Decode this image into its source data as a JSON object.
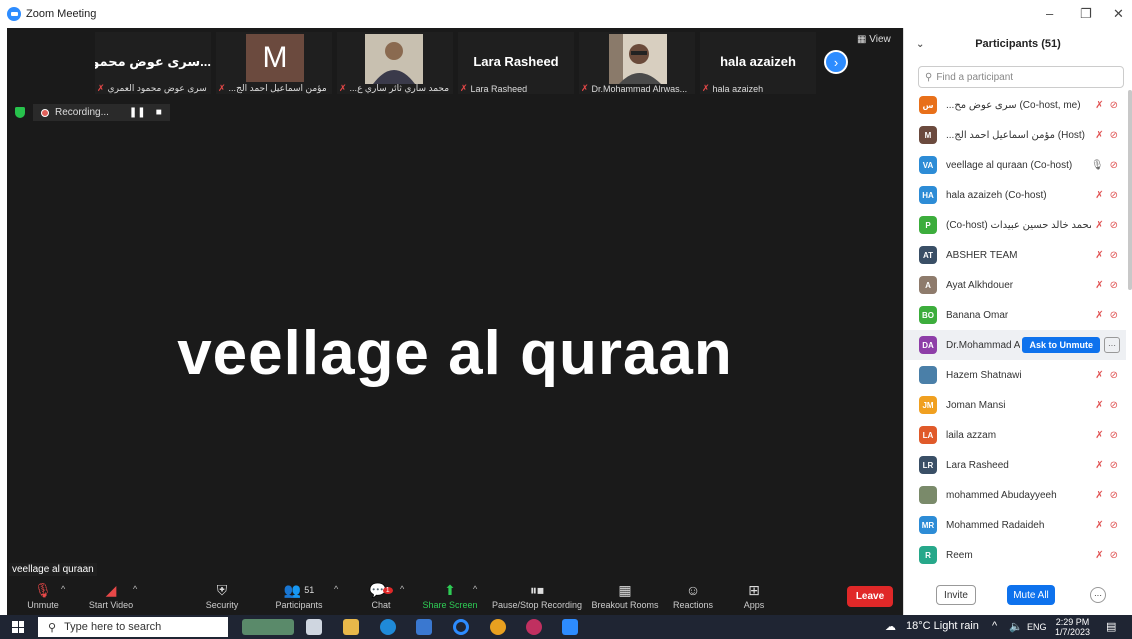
{
  "window": {
    "title": "Zoom Meeting",
    "controls": [
      "–",
      "❐",
      "✕"
    ]
  },
  "strip": {
    "tiles": [
      {
        "big": "...سرى عوض محمود",
        "caption": "سرى عوض محمود العمري"
      },
      {
        "big": "M",
        "caption": "...مؤمن اسماعيل احمد الج"
      },
      {
        "big": "",
        "caption": "...محمد ساري ثائر ساري ع"
      },
      {
        "big": "Lara Rasheed",
        "caption": "Lara Rasheed"
      },
      {
        "big": "",
        "caption": "Dr.Mohammad Alrwas..."
      },
      {
        "big": "hala azaizeh",
        "caption": "hala azaizeh"
      }
    ],
    "view_label": "View"
  },
  "recording": {
    "label": "Recording..."
  },
  "speaker": {
    "name": "veellage al quraan",
    "label": "veellage al quraan"
  },
  "toolbar": {
    "unmute": "Unmute",
    "start_video": "Start Video",
    "security": "Security",
    "participants": "Participants",
    "participants_count": "51",
    "chat": "Chat",
    "chat_badge": "1",
    "share_screen": "Share Screen",
    "pause_stop": "Pause/Stop Recording",
    "breakout": "Breakout Rooms",
    "reactions": "Reactions",
    "apps": "Apps",
    "leave": "Leave"
  },
  "participants_panel": {
    "title": "Participants (51)",
    "search_placeholder": "Find a participant",
    "rows": [
      {
        "initials": "س",
        "name": "...سرى عوض مح (Co-host, me)",
        "color": "#e8701a"
      },
      {
        "initials": "M",
        "name": "...مؤمن اسماعيل احمد الج (Host)",
        "color": "#6b4a3e"
      },
      {
        "initials": "VA",
        "name": "veellage al quraan (Co-host)",
        "color": "#2d8cd6"
      },
      {
        "initials": "HA",
        "name": "hala azaizeh (Co-host)",
        "color": "#2d8cd6"
      },
      {
        "initials": "P",
        "name": "(Co-host) محمد خالد حسين عبيدات",
        "color": "#3cad3c"
      },
      {
        "initials": "AT",
        "name": "ABSHER TEAM",
        "color": "#3a4f66"
      },
      {
        "initials": "A",
        "name": "Ayat Alkhdouer",
        "color": "#8e7b6c"
      },
      {
        "initials": "BO",
        "name": "Banana Omar",
        "color": "#3cad3c"
      },
      {
        "initials": "DA",
        "name": "Dr.Mohammad A",
        "color": "#8e3ea8"
      },
      {
        "initials": "",
        "name": "Hazem Shatnawi",
        "color": "#4a7fa8"
      },
      {
        "initials": "JM",
        "name": "Joman Mansi",
        "color": "#f0a020"
      },
      {
        "initials": "LA",
        "name": "laila azzam",
        "color": "#e05a2a"
      },
      {
        "initials": "LR",
        "name": "Lara Rasheed",
        "color": "#3a4f66"
      },
      {
        "initials": "",
        "name": "mohammed Abudayyeeh",
        "color": "#7a8a6a"
      },
      {
        "initials": "MR",
        "name": "Mohammed Radaideh",
        "color": "#2d8cd6"
      },
      {
        "initials": "R",
        "name": "Reem",
        "color": "#27a88a"
      }
    ],
    "ask_to_unmute": "Ask to Unmute",
    "invite": "Invite",
    "mute_all": "Mute All"
  },
  "taskbar": {
    "search_placeholder": "Type here to search",
    "weather": "18°C  Light rain",
    "lang": "ENG",
    "time": "2:29 PM",
    "date": "1/7/2023"
  }
}
